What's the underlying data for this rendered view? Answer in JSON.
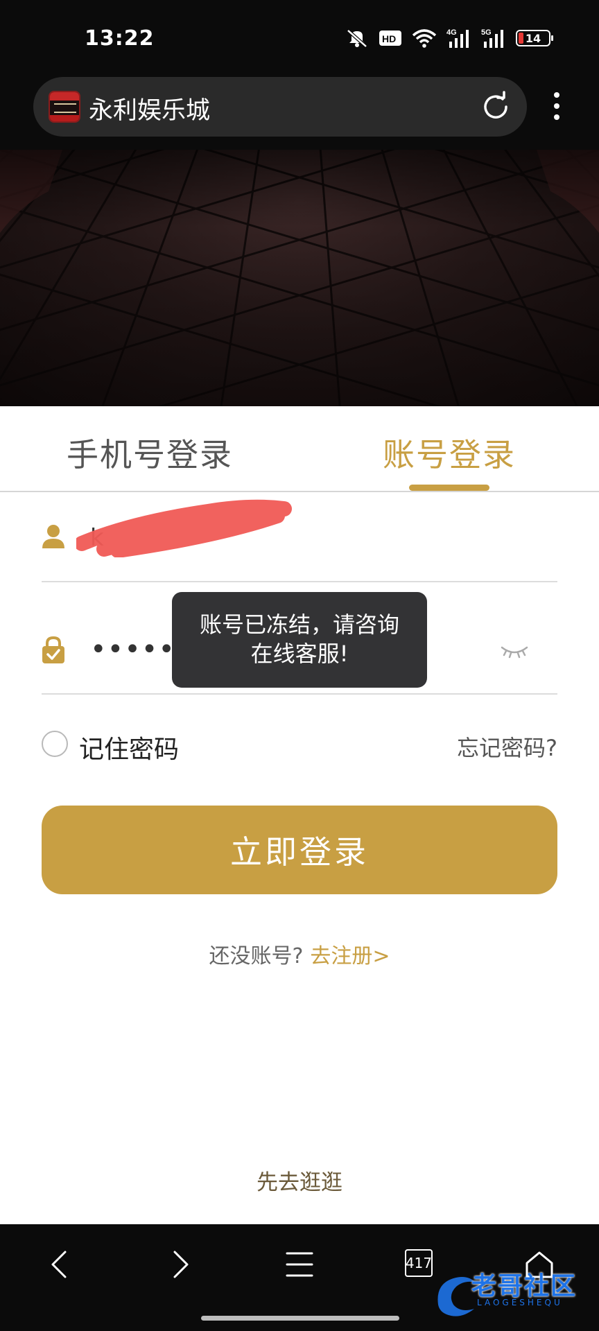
{
  "status_bar": {
    "time": "13:22",
    "icons": [
      "mute-icon",
      "hd-icon",
      "wifi-icon",
      "signal-4g-icon",
      "signal-5g-icon"
    ],
    "hd_label": "HD",
    "battery_level": "14"
  },
  "browser": {
    "site_title": "永利娱乐城",
    "icons": [
      "site-logo",
      "reload-icon",
      "more-menu-icon"
    ]
  },
  "tabs": {
    "phone_login": "手机号登录",
    "account_login": "账号登录",
    "active": "account_login"
  },
  "form": {
    "username_partial": "k",
    "password_masked": "••••••••",
    "remember_label": "记住密码",
    "remember_checked": false,
    "forgot_label": "忘记密码?",
    "login_button": "立即登录"
  },
  "toast": {
    "line1": "账号已冻结，请咨询",
    "line2": "在线客服!"
  },
  "register": {
    "question": "还没账号?",
    "link": "去注册>"
  },
  "browse_link": "先去逛逛",
  "bottom_nav": {
    "tab_count": "417",
    "icons": [
      "back-icon",
      "forward-icon",
      "menu-icon",
      "tabs-icon",
      "home-icon"
    ]
  },
  "watermark": {
    "text": "老哥社区",
    "sub": "LAOGESHEQU"
  },
  "colors": {
    "accent": "#c89f43",
    "toast_bg": "#333335",
    "bar_bg": "#0b0b0b"
  }
}
